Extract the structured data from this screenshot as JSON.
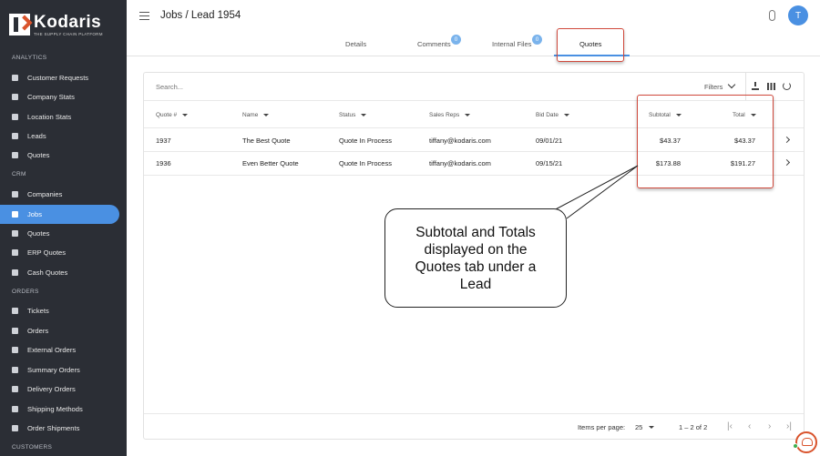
{
  "brand": {
    "name": "Kodaris",
    "tagline": "THE SUPPLY CHAIN PLATFORM"
  },
  "sidebar": {
    "sections": [
      {
        "label": "ANALYTICS",
        "items": [
          {
            "label": "Customer Requests",
            "icon": "chart-icon"
          },
          {
            "label": "Company Stats",
            "icon": "chart-icon"
          },
          {
            "label": "Location Stats",
            "icon": "chart-icon"
          },
          {
            "label": "Leads",
            "icon": "chart-icon"
          },
          {
            "label": "Quotes",
            "icon": "chart-icon"
          }
        ]
      },
      {
        "label": "CRM",
        "items": [
          {
            "label": "Companies",
            "icon": "building-icon"
          },
          {
            "label": "Jobs",
            "icon": "briefcase-icon",
            "active": true
          },
          {
            "label": "Quotes",
            "icon": "document-icon"
          },
          {
            "label": "ERP Quotes",
            "icon": "document-icon"
          },
          {
            "label": "Cash Quotes",
            "icon": "document-icon"
          }
        ]
      },
      {
        "label": "ORDERS",
        "items": [
          {
            "label": "Tickets",
            "icon": "tag-icon"
          },
          {
            "label": "Orders",
            "icon": "tag-icon"
          },
          {
            "label": "External Orders",
            "icon": "arrow-icon"
          },
          {
            "label": "Summary Orders",
            "icon": "truck-icon"
          },
          {
            "label": "Delivery Orders",
            "icon": "truck-icon"
          },
          {
            "label": "Shipping Methods",
            "icon": "truck-icon"
          },
          {
            "label": "Order Shipments",
            "icon": "truck-icon"
          }
        ]
      },
      {
        "label": "CUSTOMERS",
        "items": []
      }
    ]
  },
  "header": {
    "title": "Jobs / Lead 1954",
    "avatar_initial": "T"
  },
  "tabs": [
    {
      "label": "Details",
      "badge": null
    },
    {
      "label": "Comments",
      "badge": "0"
    },
    {
      "label": "Internal Files",
      "badge": "0"
    },
    {
      "label": "Quotes",
      "badge": null,
      "active": true
    }
  ],
  "table": {
    "search_placeholder": "Search...",
    "filters_label": "Filters",
    "columns": [
      "Quote #",
      "Name",
      "Status",
      "Sales Reps",
      "Bid Date",
      "Subtotal",
      "Total"
    ],
    "rows": [
      {
        "quote": "1937",
        "name": "The Best Quote",
        "status": "Quote In Process",
        "rep": "tiffany@kodaris.com",
        "bid_date": "09/01/21",
        "subtotal": "$43.37",
        "total": "$43.37"
      },
      {
        "quote": "1936",
        "name": "Even Better Quote",
        "status": "Quote In Process",
        "rep": "tiffany@kodaris.com",
        "bid_date": "09/15/21",
        "subtotal": "$173.88",
        "total": "$191.27"
      }
    ],
    "footer": {
      "items_per_page_label": "Items per page:",
      "items_per_page": "25",
      "range": "1 – 2 of 2"
    }
  },
  "callout": {
    "text": "Subtotal and Totals displayed on the Quotes tab under a Lead"
  },
  "colors": {
    "sidebar_bg": "#2b2e35",
    "accent": "#4a90e2",
    "highlight": "#d0493c",
    "brand_orange": "#d9532c"
  }
}
